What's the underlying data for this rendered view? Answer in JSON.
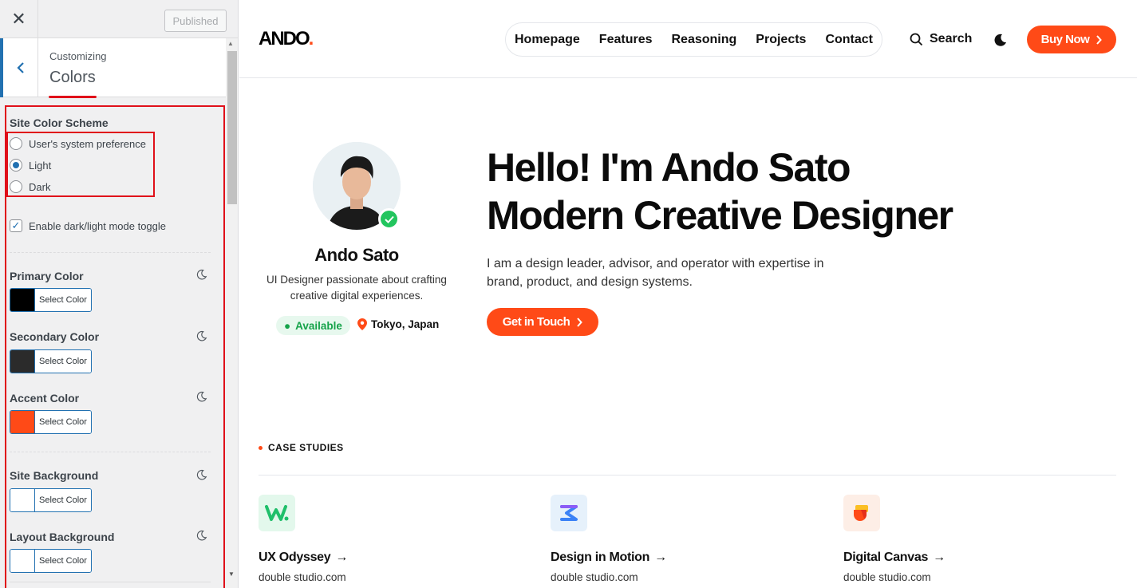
{
  "customizer": {
    "publish_label": "Published",
    "section_label": "Customizing",
    "section_title": "Colors",
    "color_scheme": {
      "heading": "Site Color Scheme",
      "options": [
        "User's system preference",
        "Light",
        "Dark"
      ],
      "selected": "Light"
    },
    "toggle": {
      "label": "Enable dark/light mode toggle",
      "checked": true
    },
    "select_color_label": "Select Color",
    "controls": [
      {
        "label": "Primary Color",
        "color": "#000000"
      },
      {
        "label": "Secondary Color",
        "color": "#2b2b2b"
      },
      {
        "label": "Accent Color",
        "color": "#ff4a17"
      },
      {
        "label": "Site Background",
        "color": "#ffffff"
      },
      {
        "label": "Layout Background",
        "color": "#ffffff"
      }
    ]
  },
  "site": {
    "logo_text": "ANDO",
    "logo_dot": ".",
    "nav": [
      "Homepage",
      "Features",
      "Reasoning",
      "Projects",
      "Contact"
    ],
    "search_label": "Search",
    "buy_label": "Buy Now",
    "profile": {
      "name": "Ando Sato",
      "bio": "UI Designer passionate about crafting creative digital experiences.",
      "status": "Available",
      "location": "Tokyo, Japan"
    },
    "hero": {
      "title_line1": "Hello! I'm Ando Sato",
      "title_line2": "Modern Creative Designer",
      "description": "I am a design leader, advisor, and operator with expertise in brand, product, and design systems.",
      "cta_label": "Get in Touch"
    },
    "case_studies": {
      "label": "CASE STUDIES",
      "items": [
        {
          "title": "UX Odyssey",
          "subtitle": "double studio.com"
        },
        {
          "title": "Design in Motion",
          "subtitle": "double studio.com"
        },
        {
          "title": "Digital Canvas",
          "subtitle": "double studio.com"
        }
      ]
    },
    "colors": {
      "accent": "#ff4a17",
      "success": "#22c55e",
      "wp_blue": "#2271b1"
    }
  }
}
